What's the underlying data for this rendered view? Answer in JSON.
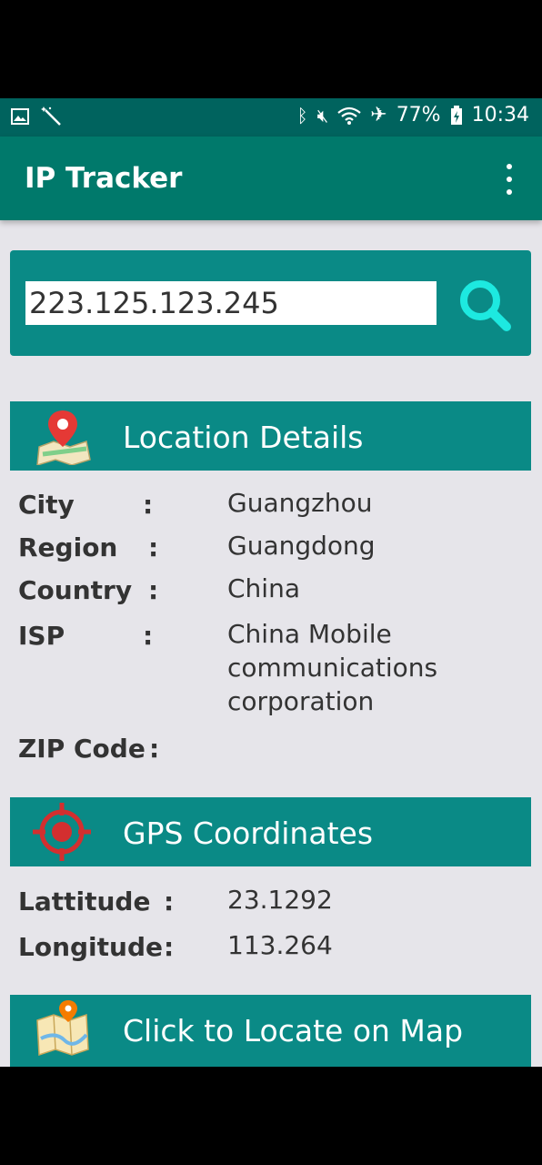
{
  "status_bar": {
    "battery": "77%",
    "time": "10:34"
  },
  "app": {
    "title": "IP Tracker"
  },
  "search": {
    "ip_value": "223.125.123.245"
  },
  "location": {
    "header": "Location Details",
    "rows": [
      {
        "label": "City",
        "colon": ":",
        "value": "Guangzhou"
      },
      {
        "label": "Region",
        "colon": ":",
        "value": "Guangdong"
      },
      {
        "label": "Country",
        "colon": ":",
        "value": "China"
      },
      {
        "label": "ISP",
        "colon": ":",
        "value": "China Mobile communications corporation"
      },
      {
        "label": "ZIP Code",
        "colon": ":",
        "value": ""
      }
    ]
  },
  "gps": {
    "header": "GPS Coordinates",
    "rows": [
      {
        "label": "Lattitude",
        "colon": ":",
        "value": "23.1292"
      },
      {
        "label": "Longitude",
        "colon": ":",
        "value": "113.264"
      }
    ]
  },
  "map_button": {
    "label": "Click to Locate on Map"
  },
  "colors": {
    "status_bar": "#00635e",
    "app_bar": "#00796b",
    "card": "#0a8a86",
    "search_icon": "#1de9e0",
    "background": "#e6e5ea"
  }
}
